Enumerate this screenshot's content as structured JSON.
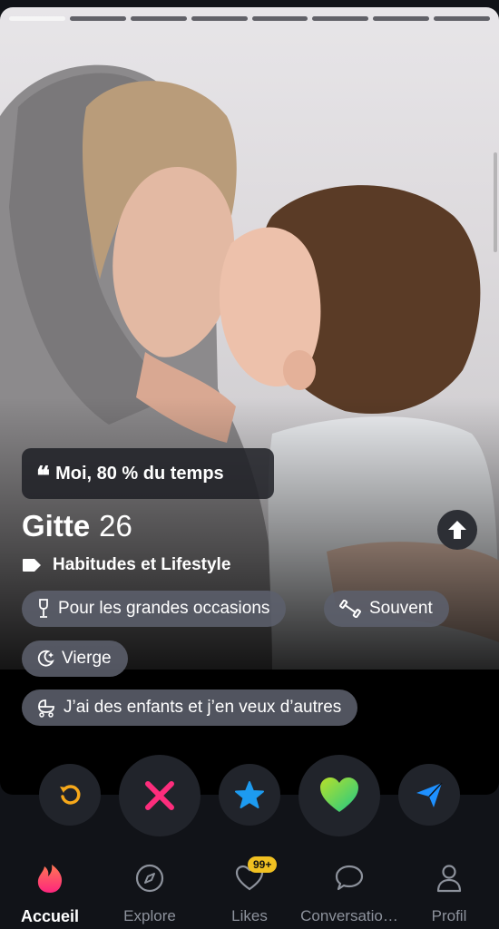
{
  "progress": {
    "total": 8,
    "current_index": 0
  },
  "profile": {
    "quote": "Moi, 80 % du temps",
    "name": "Gitte",
    "age": "26",
    "section_label": "Habitudes et Lifestyle",
    "chips": [
      {
        "icon": "wine-glass-icon",
        "label": "Pour les grandes occasions"
      },
      {
        "icon": "dumbbell-icon",
        "label": "Souvent"
      },
      {
        "icon": "moon-icon",
        "label": "Vierge"
      },
      {
        "icon": "baby-stroller-icon",
        "label": "J’ai des enfants et j’en veux d’autres"
      }
    ]
  },
  "actions": [
    {
      "name": "rewind-button",
      "icon": "rewind-icon",
      "color": "#f6a81a"
    },
    {
      "name": "nope-button",
      "icon": "close-icon",
      "color": "#fd2d7c"
    },
    {
      "name": "super-like-button",
      "icon": "star-icon",
      "color": "#1d9bf0"
    },
    {
      "name": "like-button",
      "icon": "heart-icon",
      "color": "#31d16b"
    },
    {
      "name": "boost-button",
      "icon": "paper-plane-icon",
      "color": "#1e90ff"
    }
  ],
  "tabs": [
    {
      "label": "Accueil",
      "icon": "flame-icon",
      "active": true
    },
    {
      "label": "Explore",
      "icon": "compass-icon",
      "active": false
    },
    {
      "label": "Likes",
      "icon": "heart-outline-icon",
      "badge": "99+",
      "active": false
    },
    {
      "label": "Conversatio…",
      "icon": "chat-bubble-icon",
      "active": false
    },
    {
      "label": "Profil",
      "icon": "person-icon",
      "active": false
    }
  ],
  "colors": {
    "accent": "#fd5564",
    "background": "#111318"
  }
}
